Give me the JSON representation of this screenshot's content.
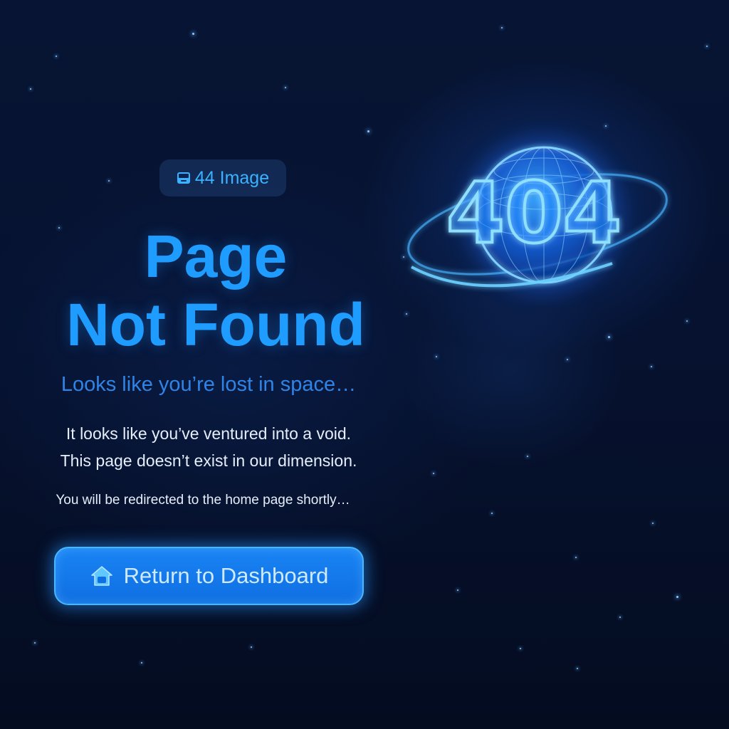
{
  "badge": {
    "icon": "image-icon",
    "label": "44 Image"
  },
  "heading": {
    "line1": "Page",
    "line2": "Not Found"
  },
  "subtitle": "Looks like you’re lost in space…",
  "description": {
    "line1": "It looks like you’ve ventured into a void.",
    "line2": "This page doesn’t exist in our dimension."
  },
  "redirect_notice": "You will be redirected to the home page shortly…",
  "cta": {
    "icon": "home-icon",
    "label": "Return to Dashboard"
  },
  "illustration": {
    "text": "404",
    "icon": "planet-icon"
  },
  "colors": {
    "background": "#061230",
    "accent": "#1e9cff",
    "subtitle": "#2f84e6",
    "button": "#1a84f4",
    "body_text": "#e6eefb"
  }
}
